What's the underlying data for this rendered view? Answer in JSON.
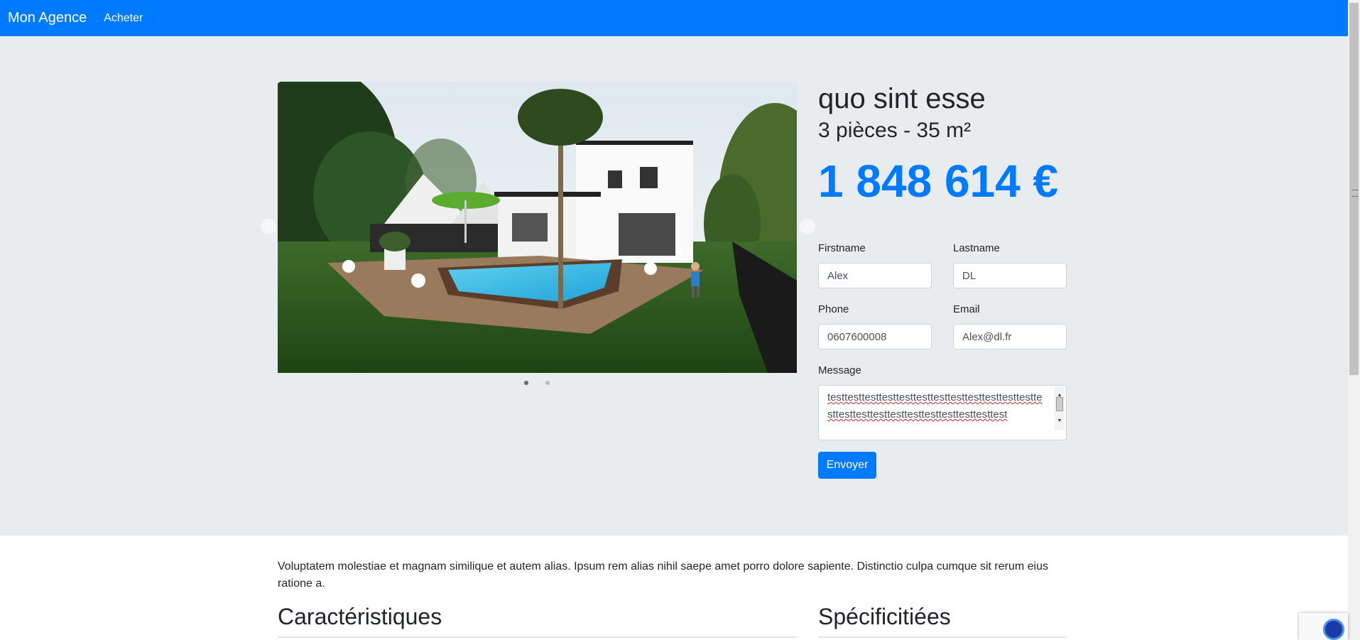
{
  "navbar": {
    "brand": "Mon Agence",
    "link": "Acheter"
  },
  "property": {
    "title": "quo sint esse",
    "subtitle": "3 pièces - 35 m²",
    "price": "1 848 614 €"
  },
  "carousel": {
    "slide_count": 2,
    "active_index": 0,
    "prev_icon": "chevron-left-icon",
    "next_icon": "chevron-right-icon"
  },
  "form": {
    "firstname_label": "Firstname",
    "firstname_value": "Alex",
    "lastname_label": "Lastname",
    "lastname_value": "DL",
    "phone_label": "Phone",
    "phone_value": "0607600008",
    "email_label": "Email",
    "email_value": "Alex@dl.fr",
    "message_label": "Message",
    "message_value": "testtesttesttesttesttesttesttesttesttesttesttesttesttesttesttesttesttesttesttesttesttesttest",
    "submit_label": "Envoyer"
  },
  "description": "Voluptatem molestiae et magnam similique et autem alias. Ipsum rem alias nihil saepe amet porro dolore sapiente. Distinctio culpa cumque sit rerum eius ratione a.",
  "sections": {
    "characteristics": "Caractéristiques",
    "specificities": "Spécificitiées"
  },
  "colors": {
    "primary": "#007bff",
    "jumbotron": "#e9ecef"
  }
}
